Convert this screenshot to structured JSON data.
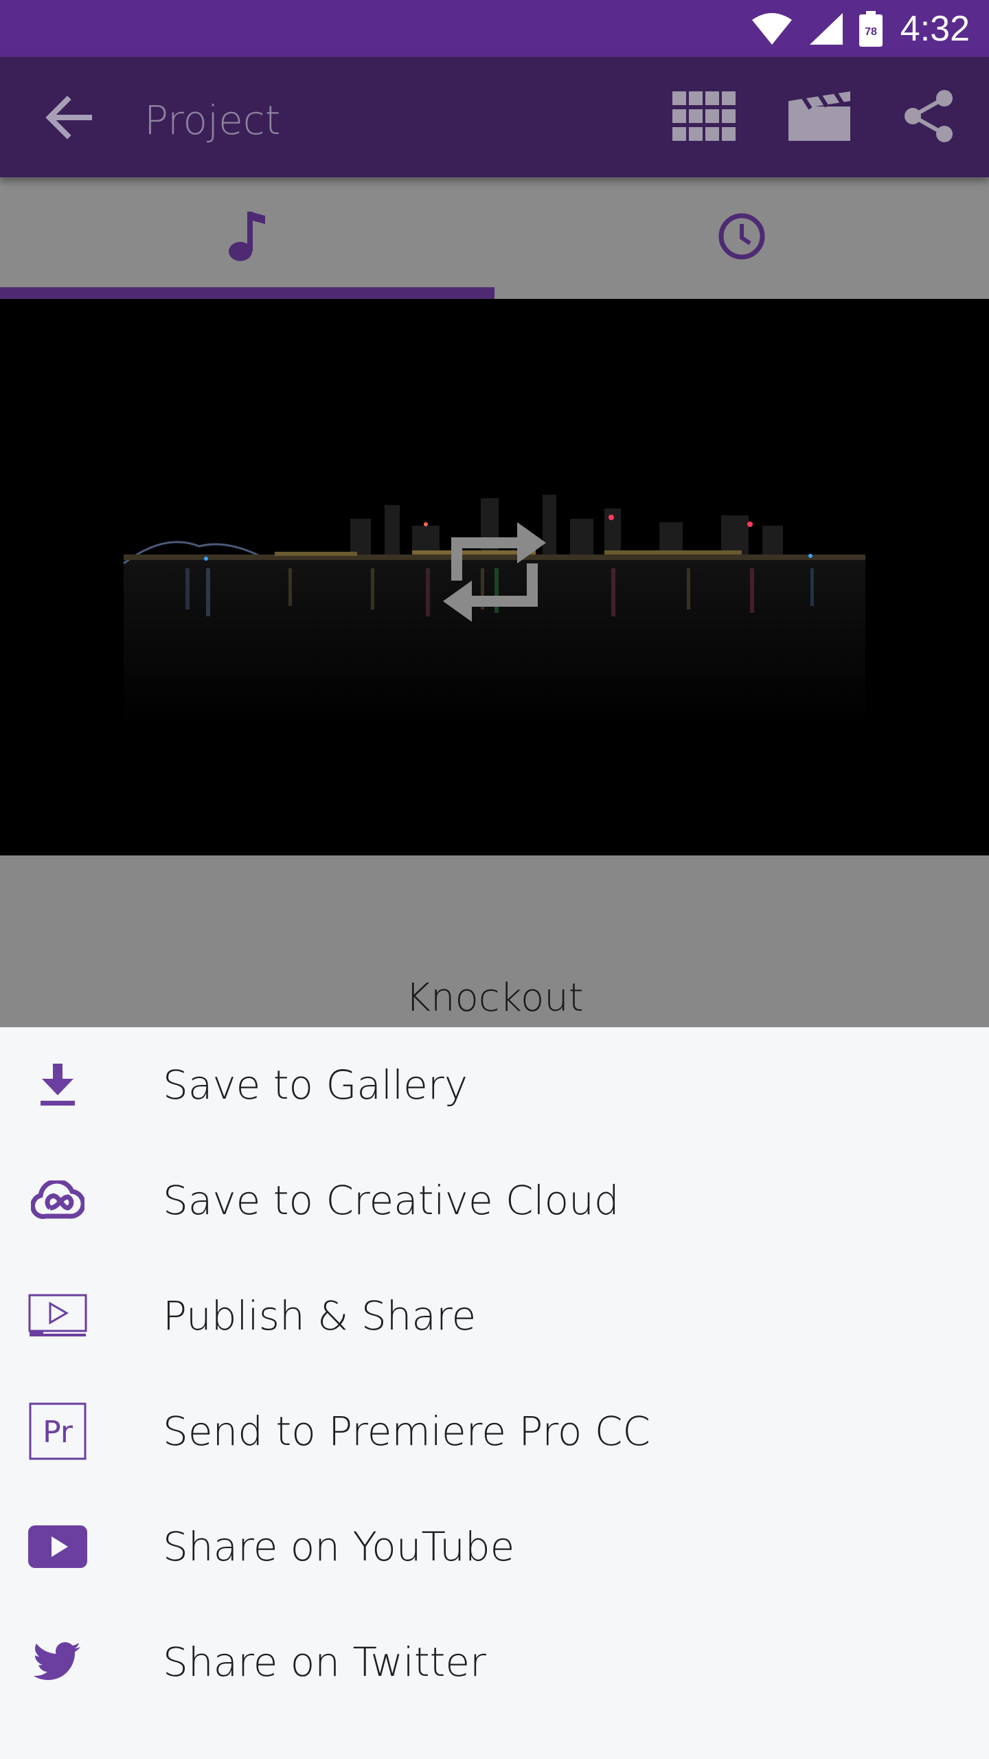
{
  "status_bar": {
    "time": "4:32",
    "battery_level": "78",
    "icons": [
      "wifi-icon",
      "signal-icon",
      "battery-icon"
    ]
  },
  "app_bar": {
    "title": "Project",
    "icons": [
      "back-arrow-icon",
      "grid-icon",
      "clapperboard-icon",
      "share-icon"
    ]
  },
  "tabs": [
    {
      "icon": "music-note-icon",
      "selected": true
    },
    {
      "icon": "clock-icon",
      "selected": false
    }
  ],
  "preview": {
    "overlay_icon": "repeat-icon",
    "theme_name": "Knockout"
  },
  "share_sheet": {
    "items": [
      {
        "label": "Save to Gallery",
        "icon": "download-icon"
      },
      {
        "label": "Save to Creative Cloud",
        "icon": "creative-cloud-icon"
      },
      {
        "label": "Publish & Share",
        "icon": "video-play-icon"
      },
      {
        "label": "Send to Premiere Pro CC",
        "icon": "premiere-pro-icon"
      },
      {
        "label": "Share on YouTube",
        "icon": "youtube-icon"
      },
      {
        "label": "Share on Twitter",
        "icon": "twitter-icon"
      }
    ]
  },
  "colors": {
    "accent": "#6b3fa0",
    "status_bar": "#5a2b8c",
    "app_bar": "#3b2057",
    "sheet_bg": "#f5f7f9"
  }
}
